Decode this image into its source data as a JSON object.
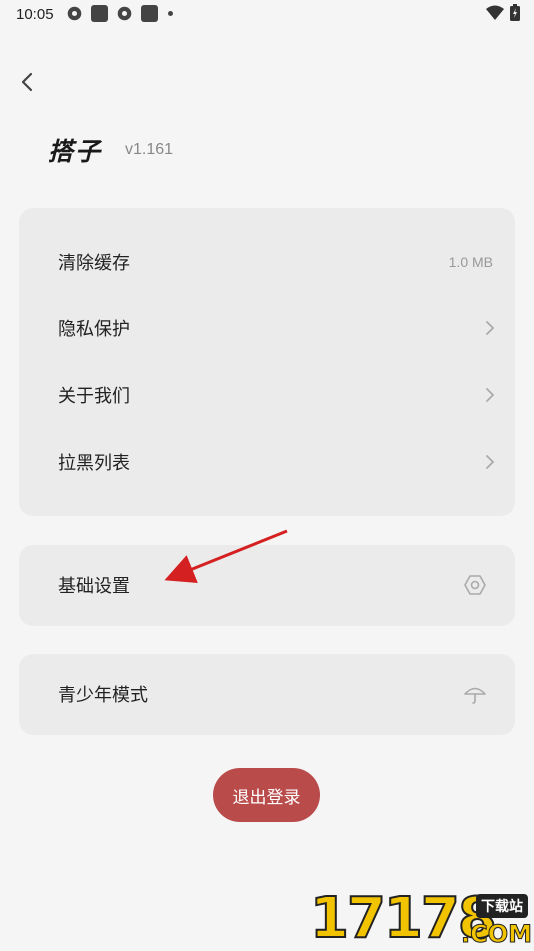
{
  "status_bar": {
    "time": "10:05"
  },
  "header": {
    "app_title": "搭子",
    "version": "v1.161"
  },
  "settings_group": [
    {
      "label": "清除缓存",
      "value": "1.0 MB"
    },
    {
      "label": "隐私保护"
    },
    {
      "label": "关于我们"
    },
    {
      "label": "拉黑列表"
    }
  ],
  "basic_settings": {
    "label": "基础设置",
    "icon": "hexagon-settings-icon"
  },
  "youth_mode": {
    "label": "青少年模式",
    "icon": "umbrella-icon"
  },
  "logout_label": "退出登录",
  "watermark": {
    "number": "17178",
    "tag": "下载站",
    "suffix": ".COM"
  },
  "colors": {
    "background": "#f5f5f5",
    "card": "#ebebeb",
    "logout": "#b94b4b",
    "annotation_arrow": "#d42020"
  }
}
